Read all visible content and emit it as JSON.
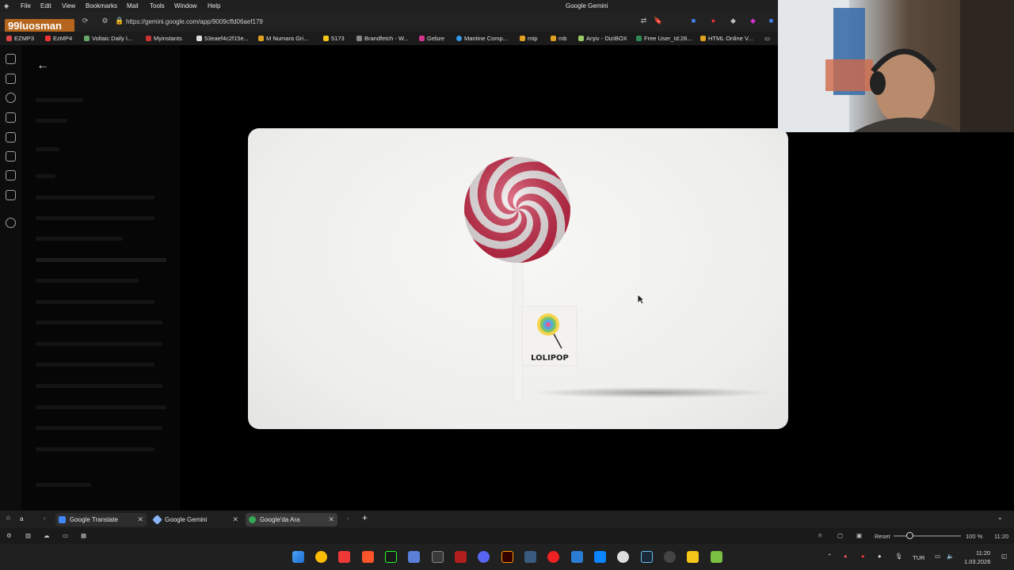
{
  "menubar": {
    "items": [
      "File",
      "Edit",
      "View",
      "Bookmarks",
      "Mail",
      "Tools",
      "Window",
      "Help"
    ],
    "window_title": "Google Gemini"
  },
  "addressbar": {
    "url": "https://gemini.google.com/app/9009cffd06aef179"
  },
  "overlay_brand": "99luosman",
  "bookmarks": [
    "EZMP3",
    "EzMP4",
    "Voltaic Daily I...",
    "Myinstants",
    "53eaef4c2f15e...",
    "M Numara Gri...",
    "5173",
    "Brandfetch - W...",
    "Gebze",
    "Mantine Comp...",
    "mtp",
    "mb",
    "Arşiv - DiziBOX",
    "Free User_Id:28...",
    "HTML Online V..."
  ],
  "bookmark_colors": {
    "ezmp3": "#d44",
    "ezmp4": "#e33",
    "voltaic": "#6a6",
    "myinstants": "#c33",
    "numara": "#e0a020",
    "gebze": "#d3358c",
    "mantine": "#339af0",
    "freeuser": "#2e8b57"
  },
  "lightbox": {
    "image_label": "LOLIPOP",
    "colors": {
      "swirl_red": "#cf2a4a",
      "swirl_white": "#f6eef0",
      "stick": "#f2f2f0",
      "flag": "#f3f2ee"
    }
  },
  "tabs": [
    {
      "label": "Google Translate",
      "color": "#4285f4"
    },
    {
      "label": "Google Gemini",
      "color": "#8ab4f8"
    },
    {
      "label": "Google'da Ara",
      "color": "#34a853"
    }
  ],
  "status": {
    "reset_label": "Reset",
    "zoom": "100 %",
    "zoom_fraction": 0.2,
    "time": "11:20"
  },
  "taskbar": {
    "lang": "TUR",
    "clock_time": "11:20",
    "clock_date": "1.03.2026"
  },
  "panel_left_label": "a"
}
